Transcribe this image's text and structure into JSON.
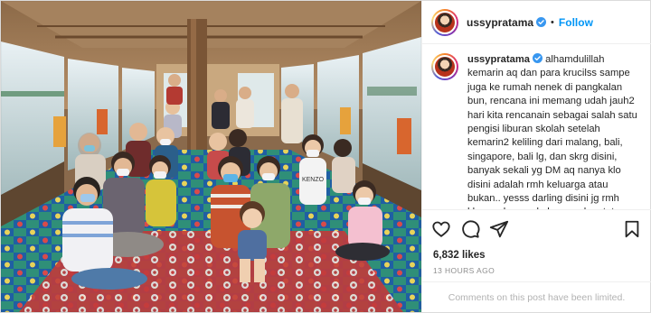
{
  "post": {
    "username": "ussypratama",
    "follow_label": "Follow",
    "separator": "•",
    "more_label": "•••",
    "caption_text": " alhamdulillah kemarin aq dan para krucilss sampe juga ke rumah nenek di pangkalan bun, rencana ini memang udah jauh2 hari kita rencanain sebagai salah satu pengisi liburan skolah setelah kemarin2 keliling dari malang, bali, singapore, bali lg, dan skrg disini, banyak sekali yg DM aq nanya klo disini adalah rmh keluarga atau bukan.. yesss darling disini jg rmh kluarga besar.. keluarga akan tetap",
    "likes": "6,832 likes",
    "timestamp": "13 HOURS AGO",
    "comments_notice": "Comments on this post have been limited."
  },
  "photo": {
    "shirt_text": "KENZO"
  },
  "icons": {
    "verified": "verified-badge-icon",
    "like": "heart-icon",
    "comment": "comment-bubble-icon",
    "share": "paper-plane-icon",
    "save": "bookmark-icon"
  },
  "colors": {
    "follow": "#0095f6",
    "verified": "#3897f0",
    "muted": "#8e8e8e"
  }
}
